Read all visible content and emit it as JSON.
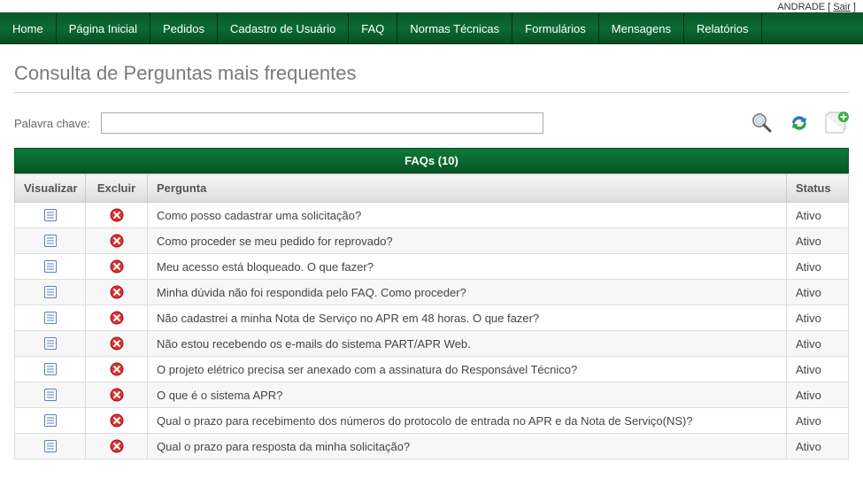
{
  "user_bar": {
    "name_partial": "ANDRADE",
    "logout_label": "Sair"
  },
  "nav": {
    "items": [
      {
        "label": "Home"
      },
      {
        "label": "Página Inicial"
      },
      {
        "label": "Pedidos"
      },
      {
        "label": "Cadastro de Usuário"
      },
      {
        "label": "FAQ"
      },
      {
        "label": "Normas Técnicas"
      },
      {
        "label": "Formulários"
      },
      {
        "label": "Mensagens"
      },
      {
        "label": "Relatórios"
      }
    ]
  },
  "page": {
    "title": "Consulta de Perguntas mais frequentes"
  },
  "search": {
    "label": "Palavra chave:",
    "value": ""
  },
  "toolbar": {
    "search_icon": "search-icon",
    "refresh_icon": "refresh-icon",
    "add_icon": "add-icon"
  },
  "table": {
    "title": "FAQs (10)",
    "columns": {
      "view": "Visualizar",
      "delete": "Excluir",
      "question": "Pergunta",
      "status": "Status"
    },
    "rows": [
      {
        "question": "Como posso cadastrar uma solicitação?",
        "status": "Ativo"
      },
      {
        "question": "Como proceder se meu pedido for reprovado?",
        "status": "Ativo"
      },
      {
        "question": "Meu acesso está bloqueado. O que fazer?",
        "status": "Ativo"
      },
      {
        "question": "Minha dúvida não foi respondida pelo FAQ. Como proceder?",
        "status": "Ativo"
      },
      {
        "question": "Não cadastrei a minha Nota de Serviço no APR em 48 horas. O que fazer?",
        "status": "Ativo"
      },
      {
        "question": "Não estou recebendo os e-mails do sistema PART/APR Web.",
        "status": "Ativo"
      },
      {
        "question": "O projeto elétrico precisa ser anexado com a assinatura do Responsável Técnico?",
        "status": "Ativo"
      },
      {
        "question": "O que é o sistema APR?",
        "status": "Ativo"
      },
      {
        "question": "Qual o prazo para recebimento dos números do protocolo de entrada no APR e da Nota de Serviço(NS)?",
        "status": "Ativo"
      },
      {
        "question": "Qual o prazo para resposta da minha solicitação?",
        "status": "Ativo"
      }
    ]
  }
}
